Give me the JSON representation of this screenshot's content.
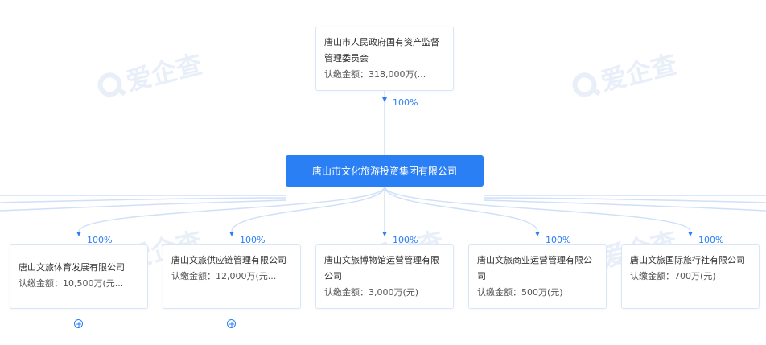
{
  "watermark": {
    "text": "爱企查"
  },
  "shareholder": {
    "name": "唐山市人民政府国有资产监督管理委员会",
    "amount": "认缴金额：318,000万(...",
    "percent": "100%"
  },
  "company": {
    "name": "唐山市文化旅游投资集团有限公司"
  },
  "subsidiaries": [
    {
      "name": "唐山文旅体育发展有限公司",
      "amount": "认缴金额：10,500万(元...",
      "percent": "100%",
      "expandable": true
    },
    {
      "name": "唐山文旅供应链管理有限公司",
      "amount": "认缴金额：12,000万(元...",
      "percent": "100%",
      "expandable": true
    },
    {
      "name": "唐山文旅博物馆运营管理有限公司",
      "amount": "认缴金额：3,000万(元)",
      "percent": "100%",
      "expandable": false
    },
    {
      "name": "唐山文旅商业运营管理有限公司",
      "amount": "认缴金额：500万(元)",
      "percent": "100%",
      "expandable": false
    },
    {
      "name": "唐山文旅国际旅行社有限公司",
      "amount": "认缴金额：700万(元)",
      "percent": "100%",
      "expandable": false
    }
  ],
  "colors": {
    "accent": "#2a7ff5",
    "line": "#cfe0f8",
    "card_border": "#d9e6f7",
    "watermark": "#e6eef9"
  }
}
